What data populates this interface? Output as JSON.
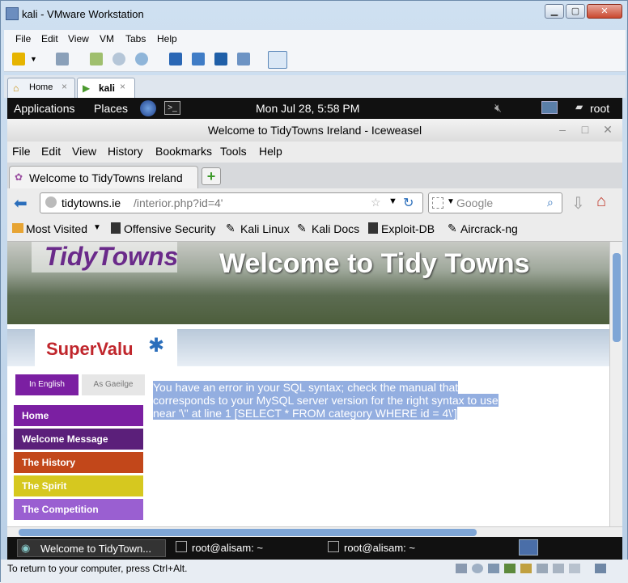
{
  "vm": {
    "title": "kali - VMware Workstation",
    "menu": [
      "File",
      "Edit",
      "View",
      "VM",
      "Tabs",
      "Help"
    ],
    "tabs": [
      {
        "label": "Home"
      },
      {
        "label": "kali"
      }
    ],
    "status_text": "To return to your computer, press Ctrl+Alt."
  },
  "gnome": {
    "applications": "Applications",
    "places": "Places",
    "datetime": "Mon Jul 28,  5:58 PM",
    "user": "root",
    "taskbar": [
      {
        "label": "Welcome to TidyTown..."
      },
      {
        "label": "root@alisam: ~"
      },
      {
        "label": "root@alisam: ~"
      }
    ]
  },
  "firefox": {
    "window_title": "Welcome to TidyTowns Ireland - Iceweasel",
    "menu": [
      "File",
      "Edit",
      "View",
      "History",
      "Bookmarks",
      "Tools",
      "Help"
    ],
    "tab_label": "Welcome to TidyTowns Ireland",
    "url_domain": "tidytowns.ie",
    "url_path": "/interior.php?id=4'",
    "search_placeholder": "Google",
    "bookmarks": [
      "Most Visited",
      "Offensive Security",
      "Kali Linux",
      "Kali Docs",
      "Exploit-DB",
      "Aircrack-ng"
    ]
  },
  "page": {
    "logo_text": "TidyTowns",
    "banner_heading": "Welcome to Tidy Towns",
    "sponsor": "SuperValu",
    "lang_english": "In English",
    "lang_irish": "As Gaeilge",
    "nav": [
      {
        "label": "Home",
        "color": "#7b1fa2"
      },
      {
        "label": "Welcome Message",
        "color": "#5b1f7a"
      },
      {
        "label": "The History",
        "color": "#c2471a"
      },
      {
        "label": "The Spirit",
        "color": "#d6c81f"
      },
      {
        "label": "The Competition",
        "color": "#9a5fd1"
      }
    ],
    "error_message": "You have an error in your SQL syntax; check the manual that corresponds to your MySQL server version for the right syntax to use near '\\'' at line 1 [SELECT * FROM category WHERE id = 4\\']"
  }
}
